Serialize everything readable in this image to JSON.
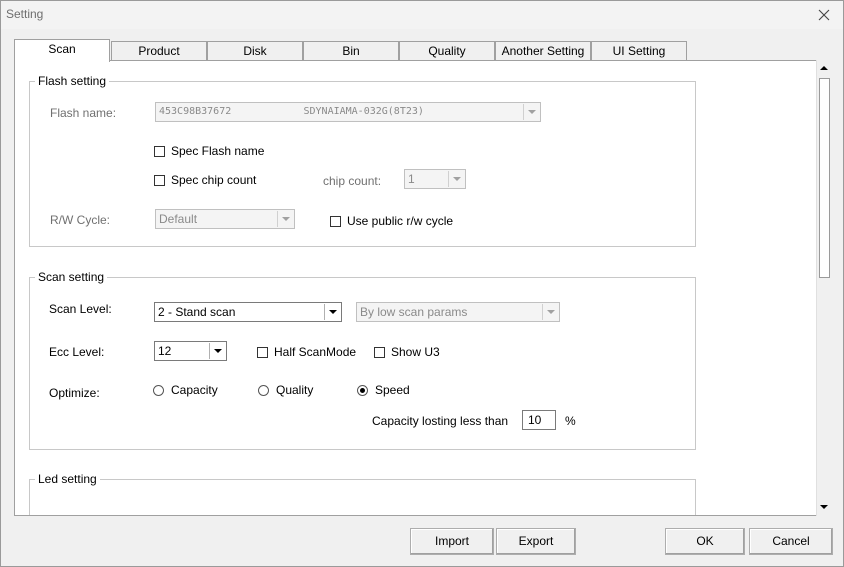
{
  "window": {
    "title": "Setting"
  },
  "tabs": [
    "Scan",
    "Product",
    "Disk",
    "Bin",
    "Quality",
    "Another Setting",
    "UI Setting"
  ],
  "active_tab": "Scan",
  "flash": {
    "legend": "Flash setting",
    "name_label": "Flash name:",
    "name_value": "453C98B37672            SDYNAIAMA-032G(8T23)",
    "spec_flash_name_label": "Spec Flash name",
    "spec_chip_count_label": "Spec chip count",
    "chip_count_label": "chip count:",
    "chip_count_value": "1",
    "rw_cycle_label": "R/W Cycle:",
    "rw_cycle_value": "Default",
    "use_public_label": "Use public r/w cycle"
  },
  "scan": {
    "legend": "Scan setting",
    "scan_level_label": "Scan Level:",
    "scan_level_value": "2 - Stand scan",
    "scan_params_value": "By low scan params",
    "ecc_label": "Ecc Level:",
    "ecc_value": "12",
    "half_scan_label": "Half ScanMode",
    "show_u3_label": "Show U3",
    "optimize_label": "Optimize:",
    "optimize_options": [
      "Capacity",
      "Quality",
      "Speed"
    ],
    "optimize_selected": "Speed",
    "capacity_losting_label": "Capacity losting less than",
    "capacity_losting_value": "10",
    "percent_label": "%"
  },
  "led": {
    "legend": "Led setting"
  },
  "buttons": {
    "import": "Import",
    "export": "Export",
    "ok": "OK",
    "cancel": "Cancel"
  }
}
